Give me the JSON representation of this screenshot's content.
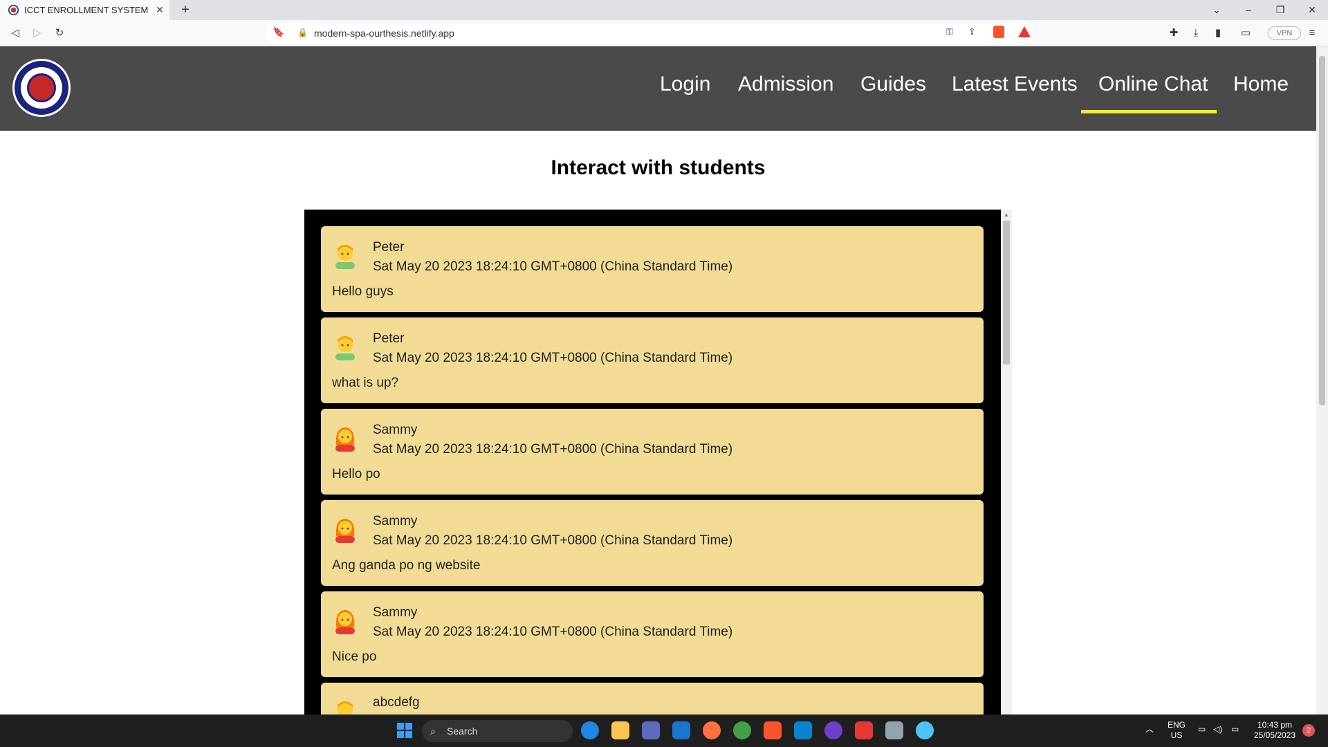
{
  "browser": {
    "tab_title": "ICCT ENROLLMENT SYSTEM",
    "url": "modern-spa-ourthesis.netlify.app",
    "vpn_label": "VPN"
  },
  "nav": {
    "items": [
      {
        "label": "Login"
      },
      {
        "label": "Admission"
      },
      {
        "label": "Guides"
      },
      {
        "label": "Latest Events"
      },
      {
        "label": "Online Chat",
        "active": true
      },
      {
        "label": "Home"
      }
    ],
    "underline_color": "#f4ee1f"
  },
  "page": {
    "title": "Interact with students"
  },
  "messages": [
    {
      "name": "Peter",
      "time": "Sat May 20 2023 18:24:10 GMT+0800 (China Standard Time)",
      "text": "Hello guys",
      "avatar": "man-emoji-icon"
    },
    {
      "name": "Peter",
      "time": "Sat May 20 2023 18:24:10 GMT+0800 (China Standard Time)",
      "text": "what is up?",
      "avatar": "man-emoji-icon"
    },
    {
      "name": "Sammy",
      "time": "Sat May 20 2023 18:24:10 GMT+0800 (China Standard Time)",
      "text": "Hello po",
      "avatar": "woman-emoji-icon"
    },
    {
      "name": "Sammy",
      "time": "Sat May 20 2023 18:24:10 GMT+0800 (China Standard Time)",
      "text": "Ang ganda po ng website",
      "avatar": "woman-emoji-icon"
    },
    {
      "name": "Sammy",
      "time": "Sat May 20 2023 18:24:10 GMT+0800 (China Standard Time)",
      "text": "Nice po",
      "avatar": "woman-emoji-icon"
    },
    {
      "name": "abcdefg",
      "time": "",
      "text": "",
      "avatar": "man-emoji-icon"
    }
  ],
  "colors": {
    "header_bg": "#4a4a4a",
    "chat_bg": "#000000",
    "message_bg": "#f2dc95"
  },
  "taskbar": {
    "search_placeholder": "Search",
    "lang_line1": "ENG",
    "lang_line2": "US",
    "clock_time": "10:43 pm",
    "clock_date": "25/05/2023",
    "notification_count": "2"
  }
}
